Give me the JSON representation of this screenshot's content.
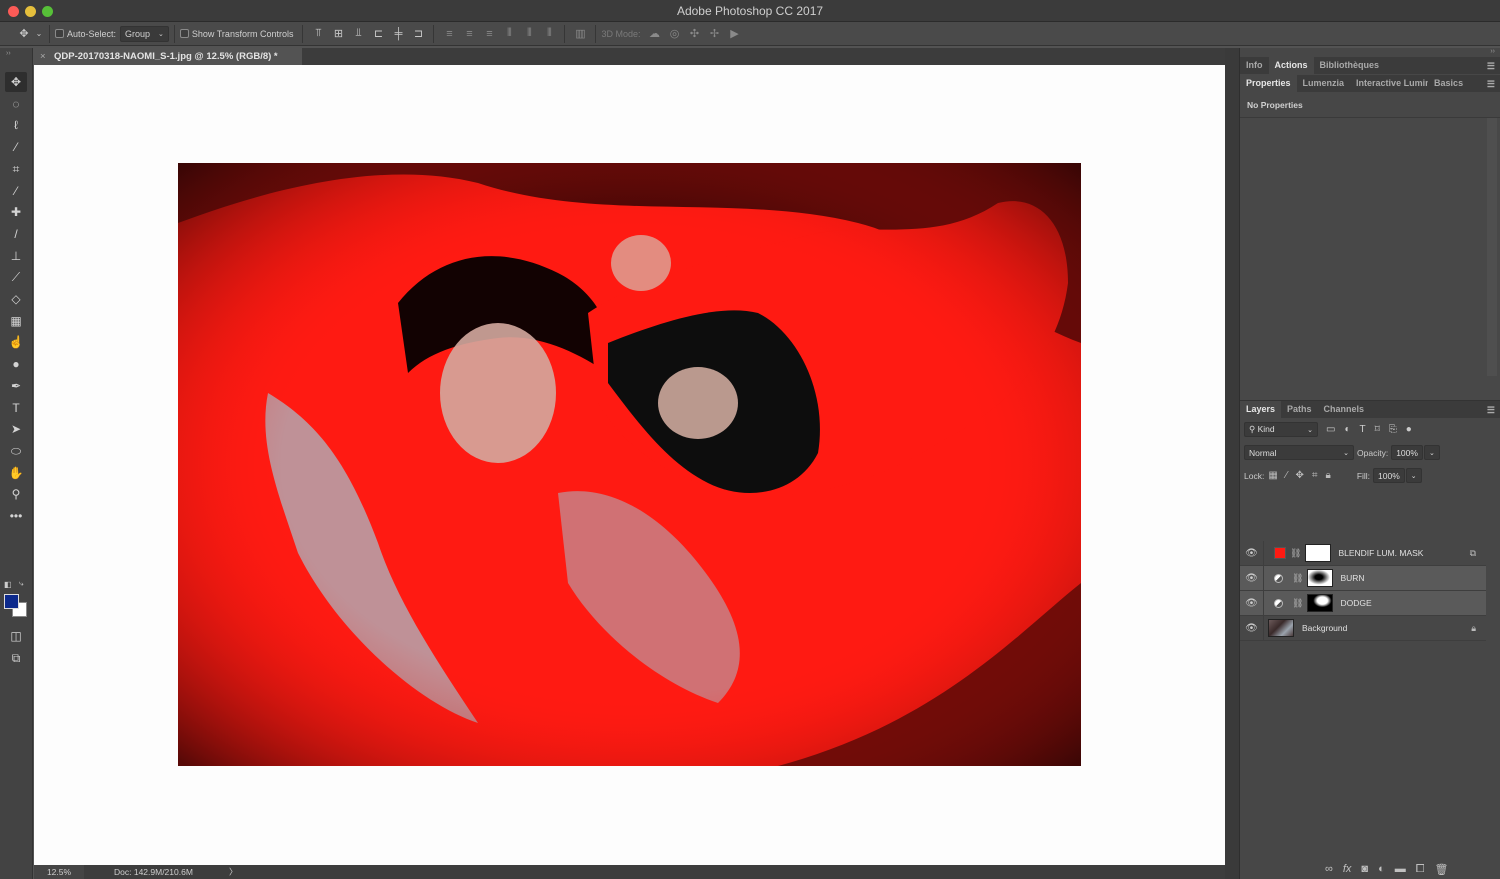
{
  "app": {
    "title": "Adobe Photoshop CC 2017"
  },
  "options_bar": {
    "auto_select_label": "Auto-Select:",
    "auto_select_checked": false,
    "auto_select_mode": "Group",
    "show_transform_label": "Show Transform Controls",
    "show_transform_checked": false,
    "mode_3d_label": "3D Mode:",
    "align_icons": [
      "align-top-edges-icon",
      "align-vertical-centers-icon",
      "align-bottom-edges-icon",
      "align-left-edges-icon",
      "align-horizontal-centers-icon",
      "align-right-edges-icon"
    ],
    "distribute_icons": [
      "distribute-top-icon",
      "distribute-vcenter-icon",
      "distribute-bottom-icon",
      "distribute-left-icon",
      "distribute-hcenter-icon",
      "distribute-right-icon"
    ],
    "auto_align_icon": "auto-align-layers-icon",
    "mode3d_icons": [
      "orbit-3d-icon",
      "roll-3d-icon",
      "drag-3d-icon",
      "slide-3d-icon",
      "scale-3d-icon"
    ]
  },
  "document": {
    "tab_title": "QDP-20170318-NAOMI_S-1.jpg @ 12.5% (RGB/8) *",
    "close_glyph": "×"
  },
  "tools": [
    {
      "name": "move-tool",
      "glyph": "✥",
      "active": true
    },
    {
      "name": "marquee-tool",
      "glyph": "◌"
    },
    {
      "name": "lasso-tool",
      "glyph": "ℓ"
    },
    {
      "name": "magic-wand-tool",
      "glyph": "⁄"
    },
    {
      "name": "crop-tool",
      "glyph": "⌗"
    },
    {
      "name": "eyedropper-tool",
      "glyph": "⁄"
    },
    {
      "name": "healing-brush-tool",
      "glyph": "✚"
    },
    {
      "name": "brush-tool",
      "glyph": "/"
    },
    {
      "name": "clone-stamp-tool",
      "glyph": "⊥"
    },
    {
      "name": "history-brush-tool",
      "glyph": "⟋"
    },
    {
      "name": "eraser-tool",
      "glyph": "◇"
    },
    {
      "name": "gradient-tool",
      "glyph": "▦"
    },
    {
      "name": "smudge-tool",
      "glyph": "☝"
    },
    {
      "name": "sponge-tool",
      "glyph": "●"
    },
    {
      "name": "pen-tool",
      "glyph": "✒"
    },
    {
      "name": "type-tool",
      "glyph": "T"
    },
    {
      "name": "path-selection-tool",
      "glyph": "➤"
    },
    {
      "name": "ellipse-tool",
      "glyph": "⬭"
    },
    {
      "name": "hand-tool",
      "glyph": "✋"
    },
    {
      "name": "zoom-tool",
      "glyph": "⚲"
    },
    {
      "name": "edit-toolbar",
      "glyph": "•••"
    }
  ],
  "colors": {
    "foreground": "#0d2a8c",
    "background": "#ffffff",
    "photo_accent": "#ff1a12"
  },
  "status": {
    "zoom": "12.5%",
    "doc_size": "Doc: 142.9M/210.6M",
    "arrow": "〉"
  },
  "panels": {
    "top_tabs": [
      {
        "label": "Info"
      },
      {
        "label": "Actions",
        "active": true
      },
      {
        "label": "Bibliothèques"
      }
    ],
    "prop_tabs": [
      {
        "label": "Properties",
        "active": true
      },
      {
        "label": "Lumenzia"
      },
      {
        "label": "Interactive Luminı"
      },
      {
        "label": "Basics"
      }
    ],
    "no_properties": "No Properties",
    "layers_tabs": [
      {
        "label": "Layers",
        "active": true
      },
      {
        "label": "Paths"
      },
      {
        "label": "Channels"
      }
    ],
    "filter_kind": "Kind",
    "blend_mode": "Normal",
    "opacity_label": "Opacity:",
    "opacity_value": "100%",
    "lock_label": "Lock:",
    "fill_label": "Fill:",
    "fill_value": "100%",
    "layers": [
      {
        "name": "BLENDIF LUM. MASK",
        "type": "fill",
        "visible": true,
        "thumb_color": "#ff1a12",
        "selected": false
      },
      {
        "name": "BURN",
        "type": "adjustment",
        "visible": true,
        "selected": true
      },
      {
        "name": "DODGE",
        "type": "adjustment",
        "visible": true,
        "selected": true
      },
      {
        "name": "Background",
        "type": "image",
        "visible": true,
        "locked": true,
        "selected": false
      }
    ],
    "bottom_icons": [
      "link-layers-icon",
      "fx-icon",
      "add-mask-icon",
      "adjustment-layer-icon",
      "new-group-icon",
      "new-layer-icon",
      "delete-layer-icon"
    ]
  }
}
